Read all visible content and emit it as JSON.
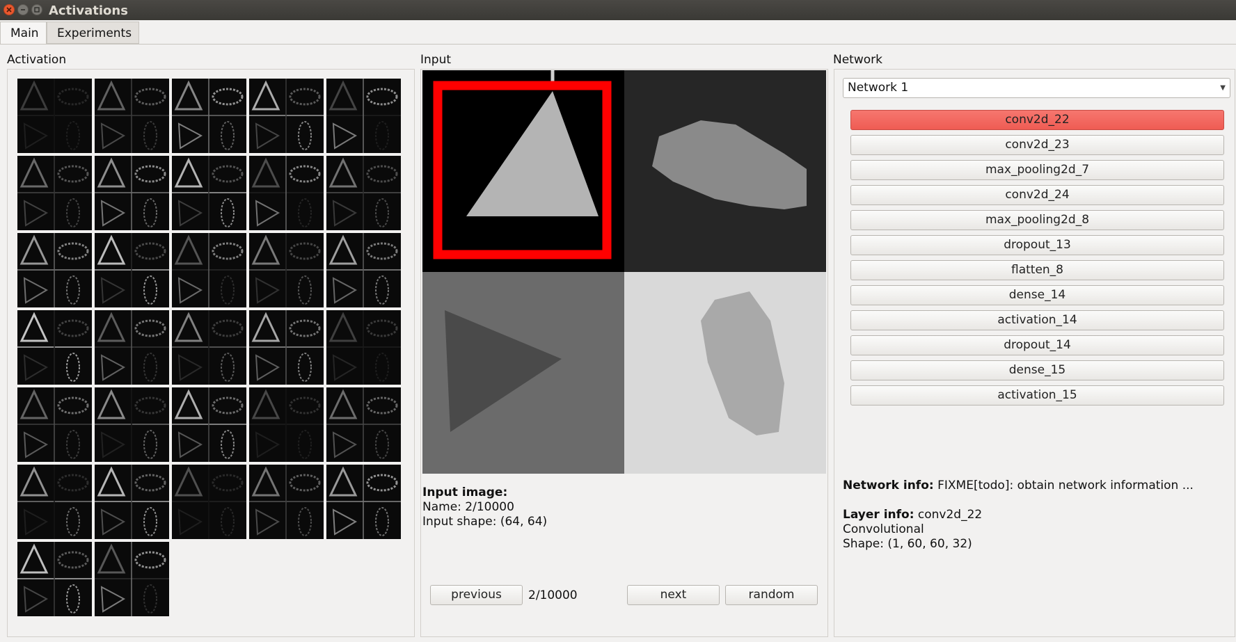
{
  "window": {
    "title": "Activations"
  },
  "tabs": [
    {
      "label": "Main"
    },
    {
      "label": "Experiments"
    }
  ],
  "activation": {
    "label": "Activation"
  },
  "input": {
    "label": "Input",
    "info_title": "Input image:",
    "name_line": "Name: 2/10000",
    "shape_line": "Input shape: (64, 64)",
    "previous_label": "previous",
    "counter": "2/10000",
    "next_label": "next",
    "random_label": "random"
  },
  "network": {
    "label": "Network",
    "selected_network": "Network 1",
    "layers": [
      {
        "label": "conv2d_22",
        "selected": true
      },
      {
        "label": "conv2d_23",
        "selected": false
      },
      {
        "label": "max_pooling2d_7",
        "selected": false
      },
      {
        "label": "conv2d_24",
        "selected": false
      },
      {
        "label": "max_pooling2d_8",
        "selected": false
      },
      {
        "label": "dropout_13",
        "selected": false
      },
      {
        "label": "flatten_8",
        "selected": false
      },
      {
        "label": "dense_14",
        "selected": false
      },
      {
        "label": "activation_14",
        "selected": false
      },
      {
        "label": "dropout_14",
        "selected": false
      },
      {
        "label": "dense_15",
        "selected": false
      },
      {
        "label": "activation_15",
        "selected": false
      }
    ],
    "network_info_title": "Network info:",
    "network_info_text": "FIXME[todo]: obtain network information ...",
    "layer_info_title": "Layer info:",
    "layer_info_name": "conv2d_22",
    "layer_info_type": "Convolutional",
    "layer_info_shape": "Shape: (1, 60, 60, 32)"
  },
  "colors": {
    "selected_layer": "#ef5c53",
    "highlight_box": "#ff0000"
  }
}
